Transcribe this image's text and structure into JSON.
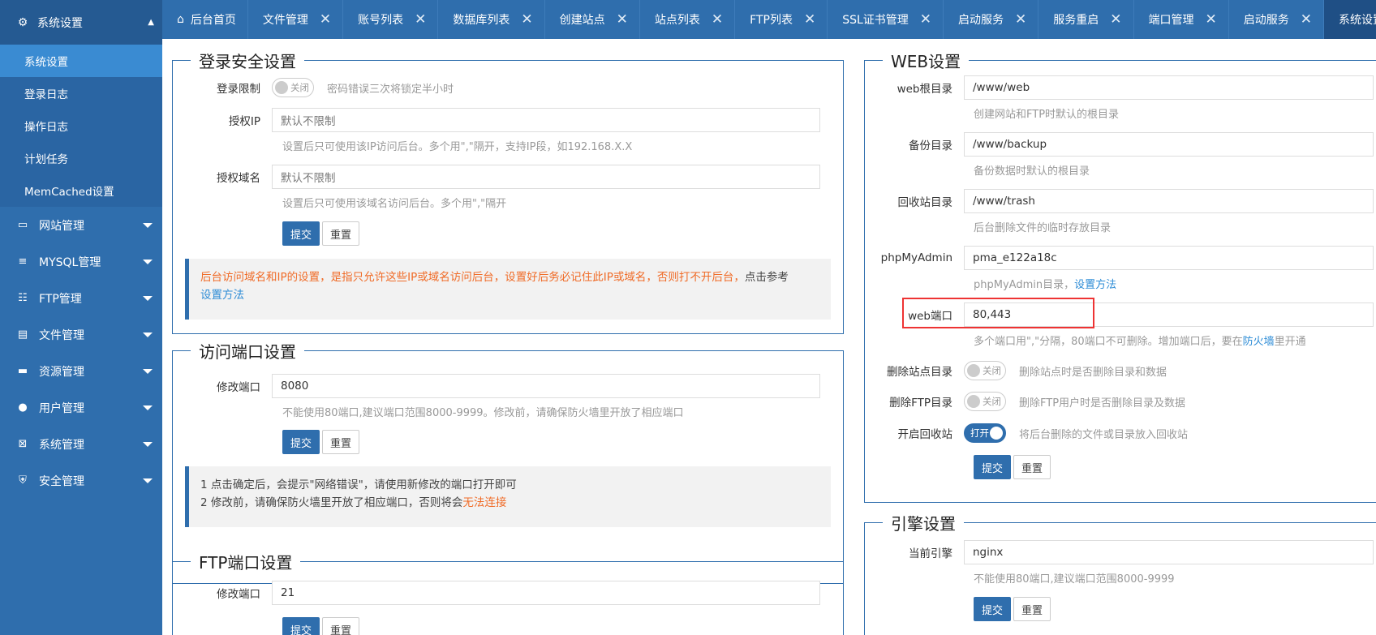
{
  "sidebar": {
    "top": {
      "label": "系统设置",
      "icon": "gear-icon"
    },
    "sub_items": [
      {
        "label": "系统设置",
        "active": true
      },
      {
        "label": "登录日志",
        "active": false
      },
      {
        "label": "操作日志",
        "active": false
      },
      {
        "label": "计划任务",
        "active": false
      },
      {
        "label": "MemCached设置",
        "active": false
      }
    ],
    "groups": [
      {
        "label": "网站管理",
        "icon": "monitor-icon"
      },
      {
        "label": "MYSQL管理",
        "icon": "database-icon"
      },
      {
        "label": "FTP管理",
        "icon": "ftp-icon"
      },
      {
        "label": "文件管理",
        "icon": "file-icon"
      },
      {
        "label": "资源管理",
        "icon": "server-icon"
      },
      {
        "label": "用户管理",
        "icon": "user-icon"
      },
      {
        "label": "系统管理",
        "icon": "system-icon"
      },
      {
        "label": "安全管理",
        "icon": "shield-icon"
      }
    ]
  },
  "tabs": [
    {
      "label": "后台首页",
      "home": true
    },
    {
      "label": "文件管理"
    },
    {
      "label": "账号列表"
    },
    {
      "label": "数据库列表"
    },
    {
      "label": "创建站点"
    },
    {
      "label": "站点列表"
    },
    {
      "label": "FTP列表"
    },
    {
      "label": "SSL证书管理"
    },
    {
      "label": "启动服务"
    },
    {
      "label": "服务重启"
    },
    {
      "label": "端口管理"
    },
    {
      "label": "启动服务"
    },
    {
      "label": "系统设置",
      "current": true
    }
  ],
  "login_security": {
    "legend": "登录安全设置",
    "login_limit": {
      "label": "登录限制",
      "switch": "关闭",
      "desc": "密码错误三次将锁定半小时"
    },
    "auth_ip": {
      "label": "授权IP",
      "placeholder": "默认不限制",
      "help": "设置后只可使用该IP访问后台。多个用\",\"隔开，支持IP段，如192.168.X.X"
    },
    "auth_domain": {
      "label": "授权域名",
      "placeholder": "默认不限制",
      "help": "设置后只可使用该域名访问后台。多个用\",\"隔开"
    },
    "submit": "提交",
    "reset": "重置",
    "notice_warn": "后台访问域名和IP的设置，是指只允许这些IP或域名访问后台，设置好后务必记住此IP或域名，否则打不开后台，",
    "notice_ref": "点击参考",
    "notice_link": "设置方法"
  },
  "access_port": {
    "legend": "访问端口设置",
    "label": "修改端口",
    "value": "8080",
    "help": "不能使用80端口,建议端口范围8000-9999。修改前，请确保防火墙里开放了相应端口",
    "submit": "提交",
    "reset": "重置",
    "notice_line1": "1 点击确定后，会提示\"网络错误\"，请使用新修改的端口打开即可",
    "notice_line2_prefix": "2 修改前，请确保防火墙里开放了相应端口，否则将会",
    "notice_line2_warn": "无法连接"
  },
  "ftp_port": {
    "legend": "FTP端口设置",
    "label": "修改端口",
    "value": "21",
    "submit": "提交",
    "reset": "重置"
  },
  "web_settings": {
    "legend": "WEB设置",
    "web_root": {
      "label": "web根目录",
      "value": "/www/web",
      "help": "创建网站和FTP时默认的根目录"
    },
    "backup_dir": {
      "label": "备份目录",
      "value": "/www/backup",
      "help": "备份数据时默认的根目录"
    },
    "trash_dir": {
      "label": "回收站目录",
      "value": "/www/trash",
      "help": "后台删除文件的临时存放目录"
    },
    "phpmyadmin": {
      "label": "phpMyAdmin",
      "value": "pma_e122a18c",
      "help_prefix": "phpMyAdmin目录，",
      "help_link": "设置方法"
    },
    "web_port": {
      "label": "web端口",
      "value": "80,443",
      "help_prefix": "多个端口用\",\"分隔，80端口不可删除。增加端口后，要在",
      "help_link": "防火墙",
      "help_suffix": "里开通"
    },
    "delete_site_dir": {
      "label": "删除站点目录",
      "switch": "关闭",
      "desc": "删除站点时是否删除目录和数据"
    },
    "delete_ftp_dir": {
      "label": "删除FTP目录",
      "switch": "关闭",
      "desc": "删除FTP用户时是否删除目录及数据"
    },
    "recycle_bin": {
      "label": "开启回收站",
      "switch": "打开",
      "desc": "将后台删除的文件或目录放入回收站"
    },
    "submit": "提交",
    "reset": "重置"
  },
  "engine_settings": {
    "legend": "引擎设置",
    "label": "当前引擎",
    "value": "nginx",
    "help": "不能使用80端口,建议端口范围8000-9999",
    "submit": "提交",
    "reset": "重置"
  },
  "colors": {
    "primary": "#2f6ead",
    "warn": "#f06b27",
    "link": "#2d8cd6",
    "highlight": "#e33333"
  }
}
